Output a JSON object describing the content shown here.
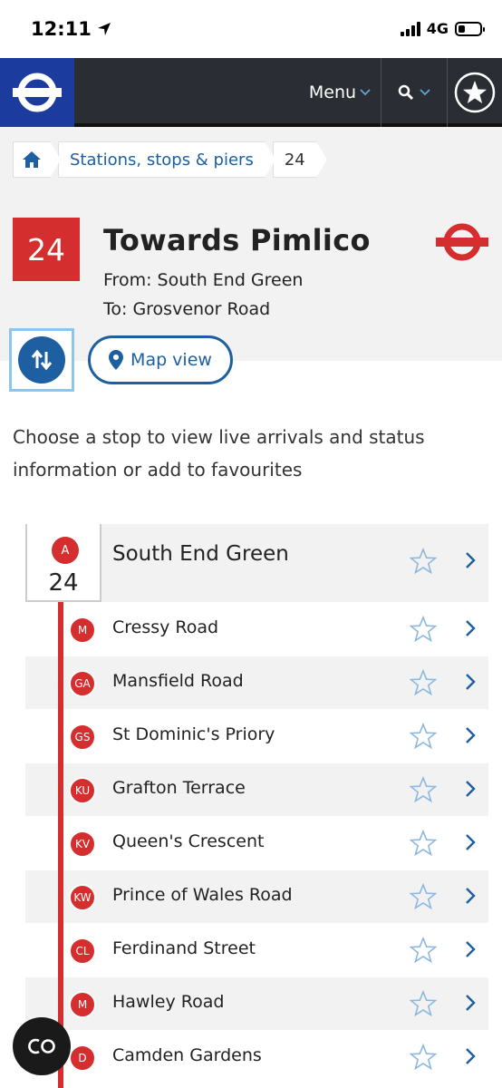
{
  "status_bar": {
    "time": "12:11",
    "network": "4G"
  },
  "header": {
    "menu_label": "Menu"
  },
  "breadcrumb": {
    "items": [
      "Stations, stops & piers",
      "24"
    ]
  },
  "route": {
    "number": "24",
    "title": "Towards Pimlico",
    "from": "From: South End Green",
    "to": "To: Grosvenor Road",
    "map_view_label": "Map view"
  },
  "instructions": "Choose a stop to view live arrivals and status information or add to favourites",
  "first_stop": {
    "letter": "A",
    "route": "24",
    "name": "South End Green"
  },
  "stops": [
    {
      "letter": "M",
      "name": "Cressy Road"
    },
    {
      "letter": "GA",
      "name": "Mansfield Road"
    },
    {
      "letter": "GS",
      "name": "St Dominic's Priory"
    },
    {
      "letter": "KU",
      "name": "Grafton Terrace"
    },
    {
      "letter": "KV",
      "name": "Queen's Crescent"
    },
    {
      "letter": "KW",
      "name": "Prince of Wales Road"
    },
    {
      "letter": "CL",
      "name": "Ferdinand Street"
    },
    {
      "letter": "M",
      "name": "Hawley Road"
    },
    {
      "letter": "D",
      "name": "Camden Gardens"
    }
  ],
  "colors": {
    "accent_red": "#d42e2e",
    "link_blue": "#1d5fa0",
    "header_bg": "#2a2d33",
    "logo_blue": "#1b3b9e"
  }
}
